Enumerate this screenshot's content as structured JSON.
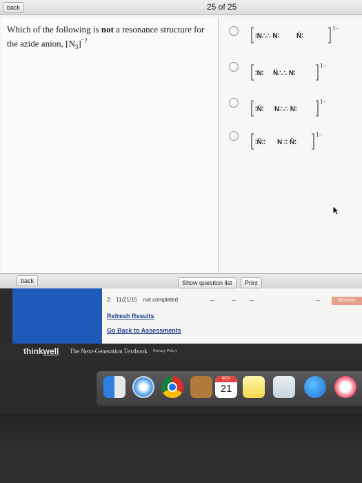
{
  "topbar": {
    "back_label": "back",
    "counter": "25 of 25"
  },
  "question": {
    "pre": "Which of the following is ",
    "emph": "not",
    "post": " a resonance structure for the azide anion, [N",
    "sub": "3",
    "sup": "]",
    "tail": "⁻?"
  },
  "options": [
    {
      "left": "∶N∴∴ N∶",
      "mid": "N̈∶",
      "charge": "1−"
    },
    {
      "left": "∶N∶",
      "mid": "N̈∴∴ N∶",
      "charge": "1−"
    },
    {
      "left": "∶N̈∶",
      "mid": "N∴∴ N∶",
      "charge": "1−"
    },
    {
      "left": "∶N̈∶∶",
      "mid": "N ∶∶ N̈∶",
      "charge": "1−"
    }
  ],
  "bottombar": {
    "back_label": "back",
    "show_list_label": "Show question list",
    "print_label": "Print"
  },
  "results": {
    "row_number": "2:",
    "date": "11/21/15",
    "status": "not completed",
    "dash": "--",
    "pill": "Resume",
    "refresh_link": "Refresh Results",
    "assessments_link": "Go Back to Assessments"
  },
  "footer": {
    "brand_think": "think",
    "brand_well": "well",
    "tagline": "The Next-Generation Textbook",
    "privacy": "Privacy Policy"
  },
  "dock": {
    "calendar_month": "NOV",
    "calendar_day": "21"
  },
  "colors": {
    "accent_blue": "#1f5ab8",
    "link_blue": "#1d3e8f"
  }
}
